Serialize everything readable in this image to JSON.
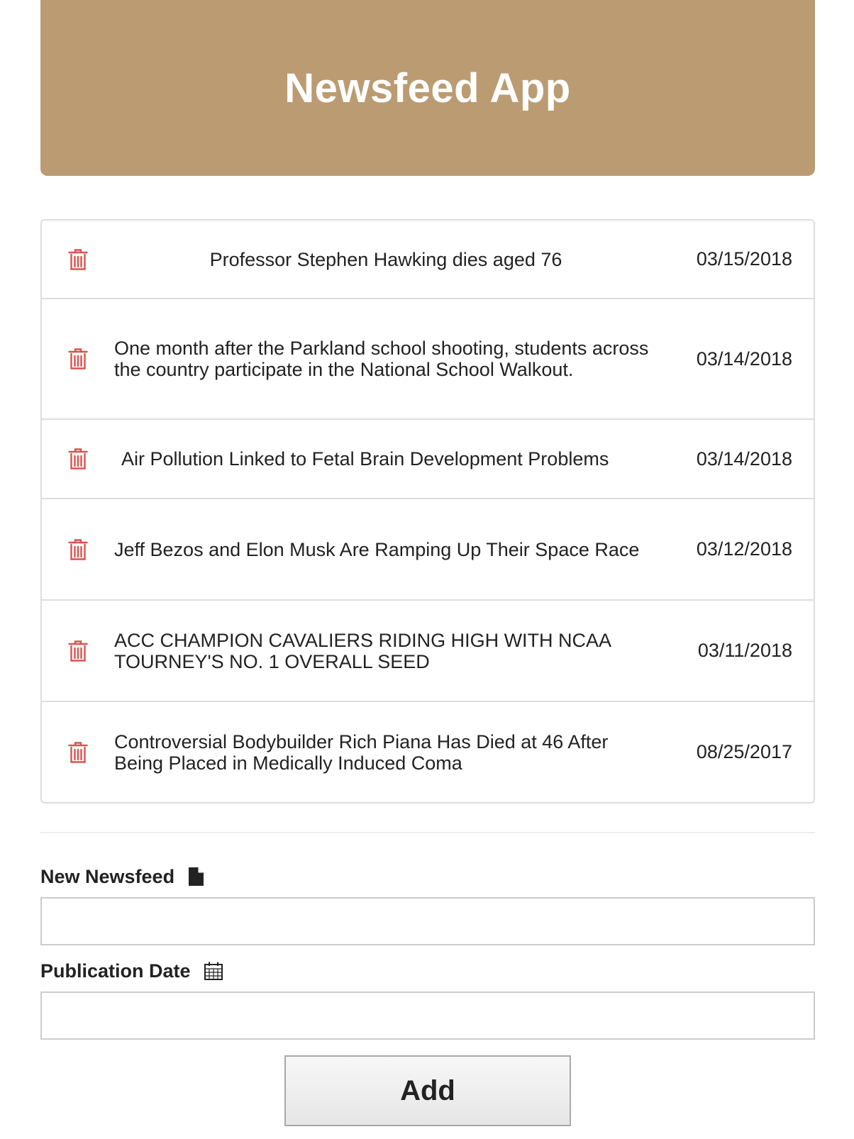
{
  "header": {
    "title": "Newsfeed App",
    "background": "#bb9b71"
  },
  "feed": {
    "items": [
      {
        "title": "Professor Stephen Hawking dies aged 76",
        "date": "03/15/2018"
      },
      {
        "title": "One month after the Parkland school shooting, students across the country participate in the National School Walkout.",
        "date": "03/14/2018"
      },
      {
        "title": "Air Pollution Linked to Fetal Brain Development Problems",
        "date": "03/14/2018"
      },
      {
        "title": "Jeff Bezos and Elon Musk Are Ramping Up Their Space Race",
        "date": "03/12/2018"
      },
      {
        "title": "ACC CHAMPION CAVALIERS RIDING HIGH WITH NCAA TOURNEY'S NO. 1 OVERALL SEED",
        "date": "03/11/2018"
      },
      {
        "title": "Controversial Bodybuilder Rich Piana Has Died at 46 After Being Placed in Medically Induced Coma",
        "date": "08/25/2017"
      }
    ],
    "delete_icon": "trash-icon",
    "delete_color": "#d9534f"
  },
  "form": {
    "newsfeed_label": "New Newsfeed",
    "newsfeed_icon": "file-icon",
    "newsfeed_value": "",
    "date_label": "Publication Date",
    "date_icon": "calendar-icon",
    "date_value": "",
    "add_label": "Add"
  }
}
